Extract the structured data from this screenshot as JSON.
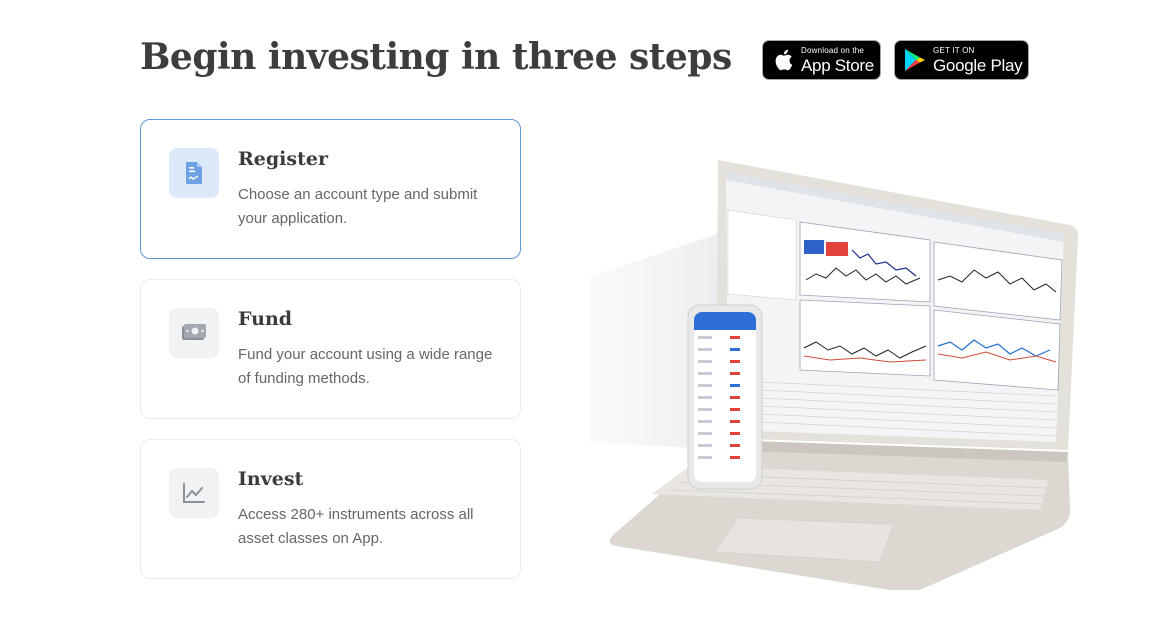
{
  "page": {
    "title": "Begin investing in three steps"
  },
  "badges": {
    "apple": {
      "small": "Download on the",
      "big": "App Store"
    },
    "google": {
      "small": "GET IT ON",
      "big": "Google Play"
    }
  },
  "steps": [
    {
      "title": "Register",
      "description": "Choose an account type and submit your application.",
      "icon": "document-icon",
      "active": true
    },
    {
      "title": "Fund",
      "description": "Fund your account using a wide range of funding methods.",
      "icon": "cash-icon",
      "active": false
    },
    {
      "title": "Invest",
      "description": "Access 280+ instruments across all asset classes on App.",
      "icon": "chart-line-icon",
      "active": false
    }
  ],
  "colors": {
    "active_border": "#5d9ad6",
    "active_icon_bg": "#dbe9fb",
    "icon_color": "#5b8fd8",
    "muted_icon": "#8a9099"
  }
}
